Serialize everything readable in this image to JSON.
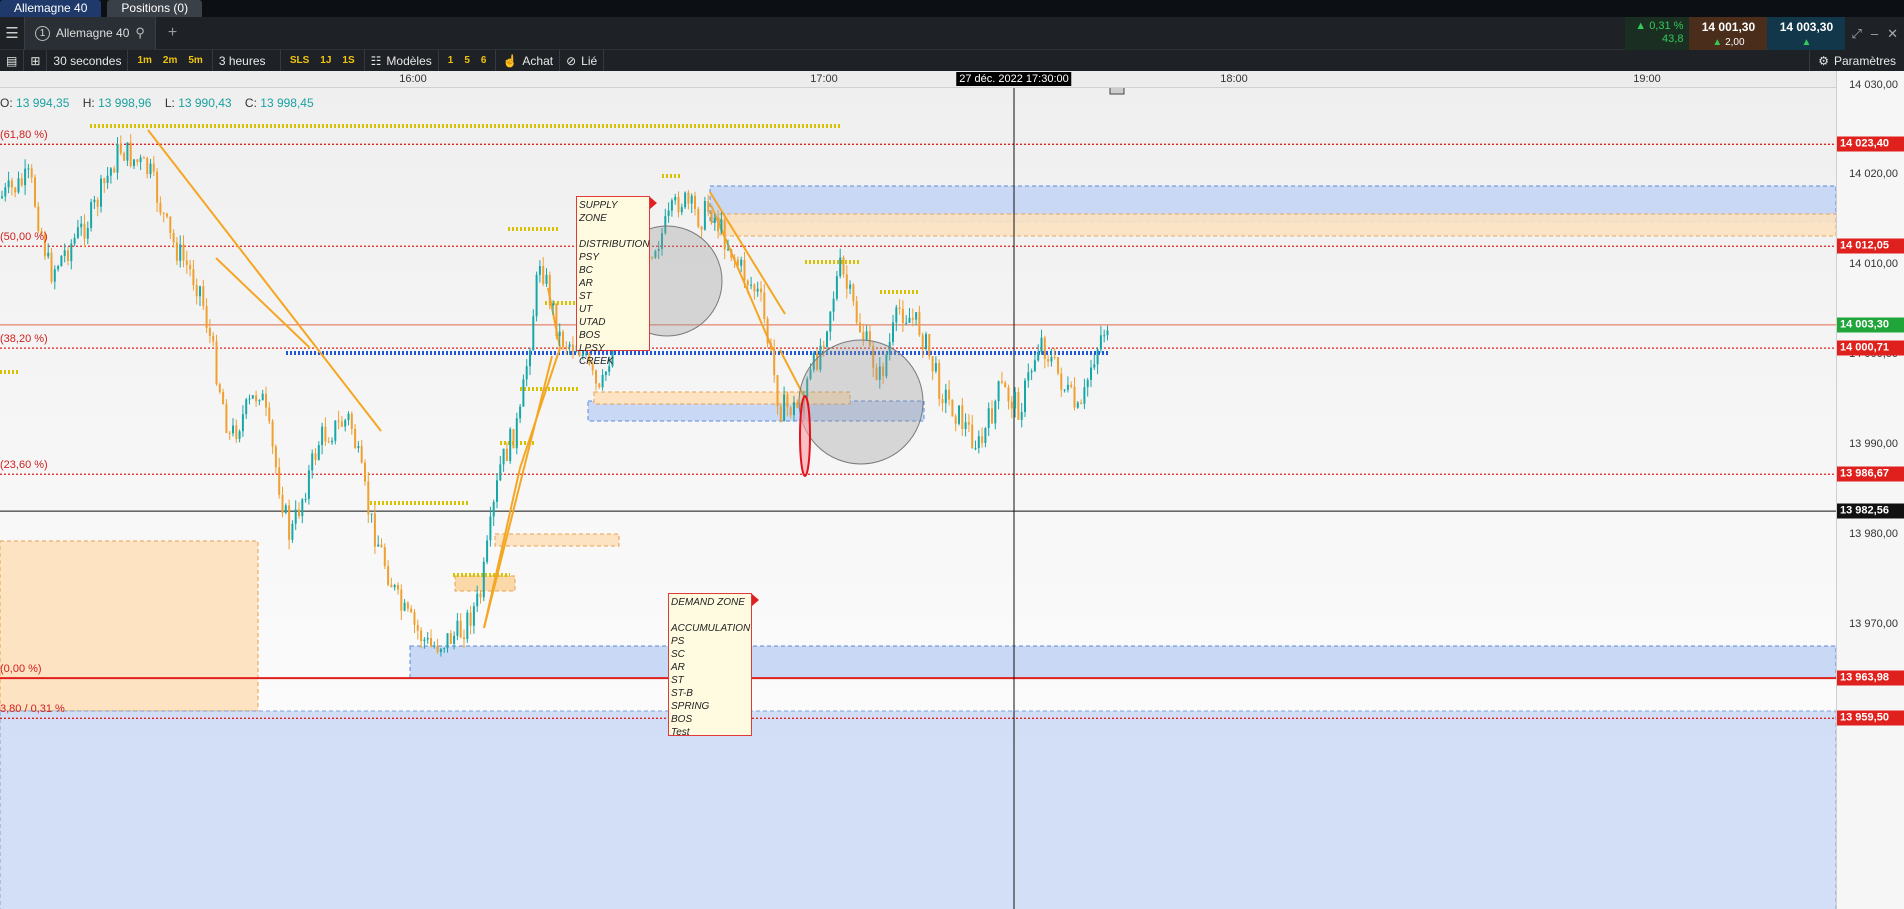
{
  "tabs": [
    {
      "label": "Allemagne 40",
      "active": true
    },
    {
      "label": "Positions (0)",
      "active": false
    }
  ],
  "instrument": {
    "number": "1",
    "name": "Allemagne 40",
    "plus": "+"
  },
  "quote": {
    "change_pct": "▲ 0,31 %",
    "change_pts": "43,8",
    "bid": "14 001,30",
    "ask": "14 003,30",
    "spread": "2,00",
    "bid_arrow": "▲",
    "ask_arrow": "▲"
  },
  "toolbar": {
    "interval": "30 secondes",
    "quick_intervals": [
      "1m",
      "2m",
      "5m"
    ],
    "period": "3 heures",
    "sls": "SLS",
    "one_j": "1J",
    "one_s": "1S",
    "models_label": "Modèles",
    "model_slots": [
      "1",
      "5",
      "6"
    ],
    "buy_label": "Achat",
    "link_label": "Lié",
    "settings_label": "Paramètres"
  },
  "time_axis": {
    "labels": [
      "16:00",
      "17:00",
      "18:00",
      "19:00"
    ],
    "cursor": "27 déc. 2022 17:30:00"
  },
  "ohlc": {
    "o_label": "O:",
    "o": "13 994,35",
    "h_label": "H:",
    "h": "13 998,96",
    "l_label": "L:",
    "l": "13 990,43",
    "c_label": "C:",
    "c": "13 998,45"
  },
  "fib_labels": [
    {
      "text": "(61,80 %)",
      "price": 14023.4
    },
    {
      "text": "(50,00 %)",
      "price": 14012.05
    },
    {
      "text": "(38,20 %)",
      "price": 14000.71
    },
    {
      "text": "(23,60 %)",
      "price": 13986.67
    },
    {
      "text": "(0,00 %)",
      "price": 13963.98
    },
    {
      "text": "3,80 / 0,31 %",
      "price": 13959.5
    }
  ],
  "price_axis": {
    "ticks": [
      "14 030,00",
      "14 020,00",
      "14 010,00",
      "14 000,00",
      "13 990,00",
      "13 980,00",
      "13 970,00"
    ],
    "tags": [
      {
        "text": "14 023,40",
        "color": "#e0201c",
        "price": 14023.4
      },
      {
        "text": "14 012,05",
        "color": "#e0201c",
        "price": 14012.05
      },
      {
        "text": "14 003,30",
        "color": "#1fa53a",
        "price": 14003.3
      },
      {
        "text": "14 000,71",
        "color": "#e0201c",
        "price": 14000.71
      },
      {
        "text": "13 986,67",
        "color": "#e0201c",
        "price": 13986.67
      },
      {
        "text": "13 982,56",
        "color": "#111111",
        "price": 13982.56
      },
      {
        "text": "13 963,98",
        "color": "#e0201c",
        "price": 13963.98
      },
      {
        "text": "13 959,50",
        "color": "#e0201c",
        "price": 13959.5
      }
    ]
  },
  "supply_zone": {
    "title": "SUPPLY ZONE",
    "items": [
      "DISTRIBUTION",
      "PSY",
      "BC",
      "AR",
      "ST",
      "UT",
      "UTAD",
      "BOS",
      "LPSY",
      "CREEK"
    ]
  },
  "demand_zone": {
    "title": "DEMAND ZONE",
    "items": [
      "ACCUMULATION",
      "PS",
      "SC",
      "AR",
      "ST",
      "ST-B",
      "SPRING",
      "BOS",
      "Test"
    ]
  },
  "colors": {
    "candle_up": "#18a7a7",
    "candle_down": "#f0a030",
    "fib_line": "#e0201c",
    "trend_line": "#f5a623",
    "zone_blue": "#c9d8f5",
    "zone_orange": "#fde3c2",
    "dotted_yellow": "#d8c200"
  }
}
